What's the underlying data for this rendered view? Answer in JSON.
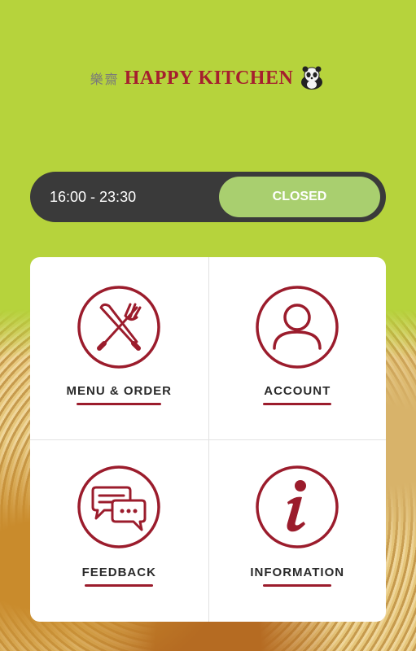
{
  "brand": {
    "chinese": "樂齋",
    "name": "HAPPY KITCHEN"
  },
  "hours": {
    "time_range": "16:00 - 23:30",
    "status": "CLOSED"
  },
  "tiles": [
    {
      "label": "MENU & ORDER",
      "icon": "cutlery-icon"
    },
    {
      "label": "ACCOUNT",
      "icon": "user-icon"
    },
    {
      "label": "FEEDBACK",
      "icon": "chat-bubbles-icon"
    },
    {
      "label": "INFORMATION",
      "icon": "info-icon"
    }
  ],
  "colors": {
    "background": "#b6d33c",
    "accent": "#9b1c2c",
    "status_pill": "#a9cf6f",
    "hours_bar": "#3a3a3a"
  }
}
